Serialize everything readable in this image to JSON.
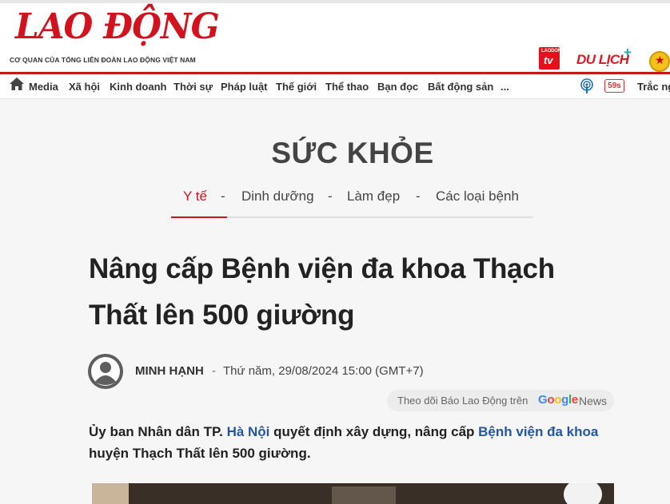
{
  "header": {
    "logo_text": "LAO ĐỘNG",
    "tagline": "CƠ QUAN CỦA TỔNG LIÊN ĐOÀN LAO ĐỘNG VIỆT NAM",
    "ldtv_small": "LAODONG",
    "ldtv_big": "tv",
    "dulich": "DU LỊCH",
    "dulich_plus": "+"
  },
  "nav": {
    "items": [
      "Media",
      "Xã hội",
      "Kinh doanh",
      "Thời sự",
      "Pháp luật",
      "Thế giới",
      "Thể thao",
      "Bạn đọc",
      "Bất động sản",
      "..."
    ],
    "badge_59s": "59s",
    "trac_nghiem": "Trắc ng"
  },
  "section": {
    "title": "SỨC KHỎE",
    "subnav": [
      "Y tế",
      "-",
      "Dinh dưỡng",
      "-",
      "Làm đẹp",
      "-",
      "Các loại bệnh"
    ]
  },
  "article": {
    "headline": "Nâng cấp Bệnh viện đa khoa Thạch Thất lên 500 giường",
    "author": "MINH HẠNH",
    "separator": "-",
    "date": "Thứ năm, 29/08/2024 15:00 (GMT+7)",
    "follow_text": "Theo dõi Báo Lao Động trên",
    "google": "Google",
    "news": "News",
    "lead_1": "Ủy ban Nhân dân TP. ",
    "lead_link_1": "Hà Nội",
    "lead_2": " quyết định xây dựng, nâng cấp ",
    "lead_link_2": "Bệnh viện đa khoa",
    "lead_3": " huyện Thạch Thất lên 500 giường."
  },
  "colors": {
    "brand_red": "#c8161d",
    "link_blue": "#2456a4"
  }
}
